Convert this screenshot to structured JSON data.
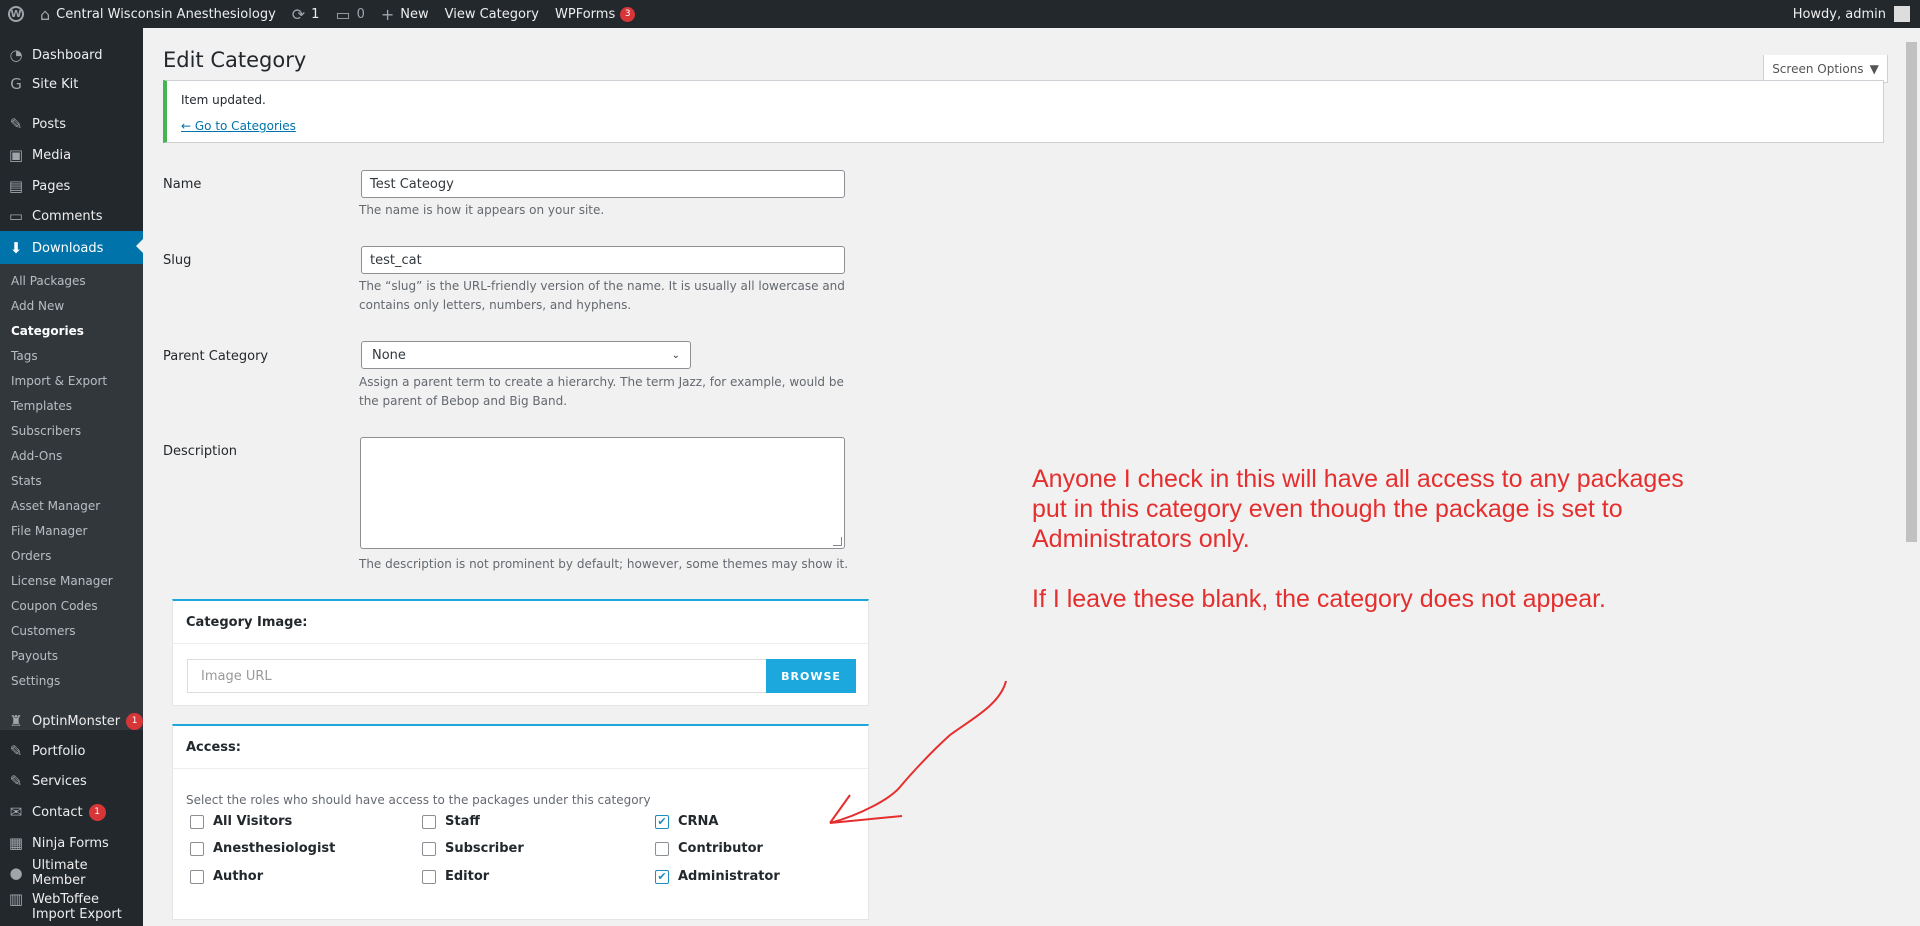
{
  "adminbar": {
    "site_name": "Central Wisconsin Anesthesiology",
    "updates_count": "1",
    "comments_count": "0",
    "new_label": "New",
    "view_category_label": "View Category",
    "wpforms_label": "WPForms",
    "wpforms_count": "3",
    "howdy": "Howdy, admin"
  },
  "sidebar": {
    "items": [
      {
        "label": "Dashboard",
        "icon": "dashboard-icon"
      },
      {
        "label": "Site Kit",
        "icon": "google-icon"
      },
      {
        "label": "Posts",
        "icon": "pin-icon"
      },
      {
        "label": "Media",
        "icon": "media-icon"
      },
      {
        "label": "Pages",
        "icon": "page-icon"
      },
      {
        "label": "Comments",
        "icon": "comment-icon"
      },
      {
        "label": "Downloads",
        "icon": "download-icon"
      }
    ],
    "submenu": [
      "All Packages",
      "Add New",
      "Categories",
      "Tags",
      "Import & Export",
      "Templates",
      "Subscribers",
      "Add-Ons",
      "Stats",
      "Asset Manager",
      "File Manager",
      "Orders",
      "License Manager",
      "Coupon Codes",
      "Customers",
      "Payouts",
      "Settings"
    ],
    "lower_items": [
      {
        "label": "OptinMonster",
        "badge": "1",
        "icon": "optinmonster-icon"
      },
      {
        "label": "Portfolio",
        "icon": "pin-icon"
      },
      {
        "label": "Services",
        "icon": "pin-icon"
      },
      {
        "label": "Contact",
        "badge": "1",
        "icon": "mail-icon"
      },
      {
        "label": "Ninja Forms",
        "icon": "forms-icon"
      },
      {
        "label": "Ultimate Member",
        "icon": "user-icon"
      },
      {
        "label": "WebToffee Import Export",
        "icon": "import-icon"
      }
    ]
  },
  "page": {
    "title": "Edit Category",
    "screen_options": "Screen Options",
    "notice_message": "Item updated.",
    "notice_link": "← Go to Categories"
  },
  "form": {
    "name_label": "Name",
    "name_value": "Test Cateogy",
    "name_desc": "The name is how it appears on your site.",
    "slug_label": "Slug",
    "slug_value": "test_cat",
    "slug_desc": "The “slug” is the URL-friendly version of the name. It is usually all lowercase and contains only letters, numbers, and hyphens.",
    "parent_label": "Parent Category",
    "parent_value": "None",
    "parent_desc": "Assign a parent term to create a hierarchy. The term Jazz, for example, would be the parent of Bebop and Big Band.",
    "description_label": "Description",
    "description_value": "",
    "description_desc": "The description is not prominent by default; however, some themes may show it."
  },
  "category_image": {
    "heading": "Category Image:",
    "placeholder": "Image URL",
    "browse_label": "BROWSE"
  },
  "access": {
    "heading": "Access:",
    "desc": "Select the roles who should have access to the packages under this category",
    "roles": [
      {
        "label": "All Visitors",
        "checked": false
      },
      {
        "label": "Staff",
        "checked": false
      },
      {
        "label": "CRNA",
        "checked": true
      },
      {
        "label": "Anesthesiologist",
        "checked": false
      },
      {
        "label": "Subscriber",
        "checked": false
      },
      {
        "label": "Contributor",
        "checked": false
      },
      {
        "label": "Author",
        "checked": false
      },
      {
        "label": "Editor",
        "checked": false
      },
      {
        "label": "Administrator",
        "checked": true
      }
    ]
  },
  "annotation": {
    "line1": "Anyone I check in this will have all access to any packages",
    "line2": "put in this category even though the package is set to",
    "line3": "Administrators only.",
    "line4": "If I leave these blank, the category does not appear.",
    "color": "#e52e2e"
  }
}
